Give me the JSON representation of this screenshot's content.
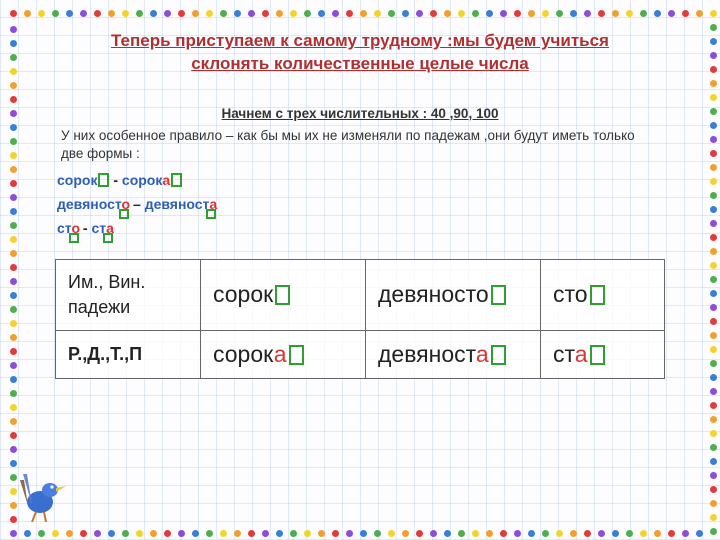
{
  "title_line1": "Теперь приступаем к самому трудному :мы будем учиться",
  "title_line2": "склонять количественные целые числа",
  "subtitle": "Начнем с трех числительных : 40 ,90, 100",
  "rule": "У них особенное правило – как бы мы их не изменяли по падежам ,они будут иметь только две формы :",
  "forms": {
    "r1a": "сорок",
    "r1sep": "  -   ",
    "r1b": "сорок",
    "r1end": "а",
    "r2a": "девяност",
    "r2aend": "о",
    "r2sep": " – ",
    "r2b": "девяност",
    "r2bend": "а",
    "r3a": "ст",
    "r3aend": "о",
    "r3sep": "  - ",
    "r3b": "ст",
    "r3bend": "а"
  },
  "table": {
    "row1_label_a": "Им., Вин.",
    "row1_label_b": "падежи",
    "row2_label": "Р.,Д.,Т.,П",
    "c1a_stem": "сорок",
    "c1a_end": "",
    "c2a_stem": "девяност",
    "c2a_end": "о",
    "c3a_stem": "ст",
    "c3a_end": "о",
    "c1b_stem": "сорок",
    "c1b_end": "а",
    "c2b_stem": "девяност",
    "c2b_end": "а",
    "c3b_stem": "ст",
    "c3b_end": "а"
  },
  "border_colors": [
    "#e23b3b",
    "#f0a030",
    "#f3d330",
    "#4fae4f",
    "#3a7fd6",
    "#8a4fd6"
  ]
}
